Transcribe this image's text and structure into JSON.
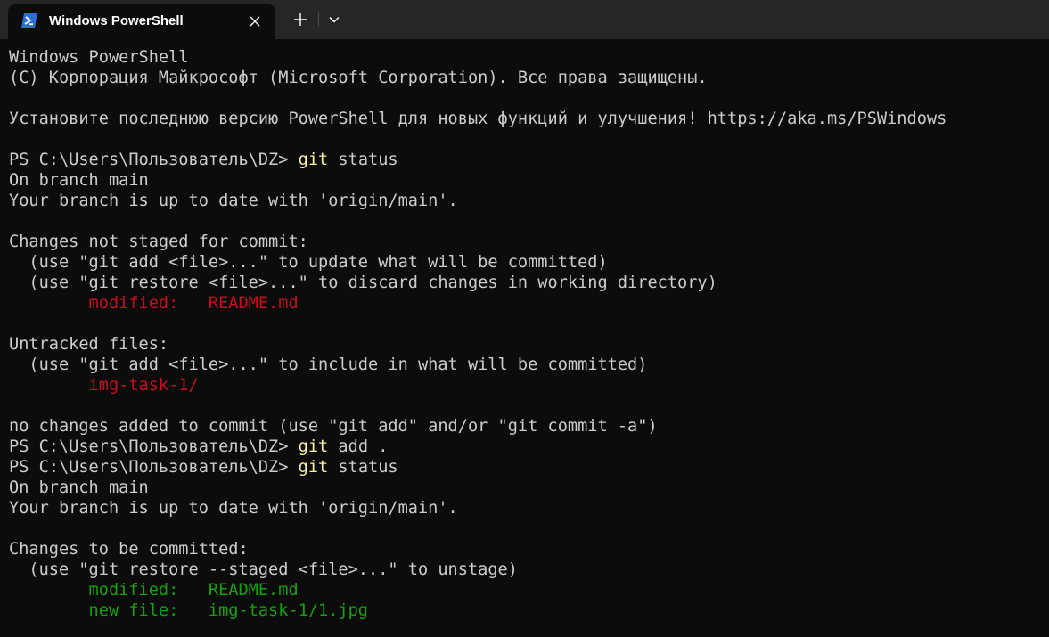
{
  "window": {
    "tab_title": "Windows PowerShell",
    "tab_icon": "powershell-icon",
    "close_icon": "close-icon",
    "new_tab_icon": "plus-icon",
    "dropdown_icon": "chevron-down-icon"
  },
  "colors": {
    "background": "#0c0c0c",
    "titlebar": "#262626",
    "text": "#cccccc",
    "command": "#f9f1a5",
    "red": "#c50f1f",
    "green": "#13a10e",
    "tab_icon": "#2b6fd6"
  },
  "terminal": {
    "lines": [
      [
        {
          "t": "Windows PowerShell"
        }
      ],
      [
        {
          "t": "(C) Корпорация Майкрософт (Microsoft Corporation). Все права защищены."
        }
      ],
      [],
      [
        {
          "t": "Установите последнюю версию PowerShell для новых функций и улучшения! https://aka.ms/PSWindows"
        }
      ],
      [],
      [
        {
          "t": "PS C:\\Users\\Пользователь\\DZ> "
        },
        {
          "t": "git",
          "c": "cmd"
        },
        {
          "t": " status"
        }
      ],
      [
        {
          "t": "On branch main"
        }
      ],
      [
        {
          "t": "Your branch is up to date with 'origin/main'."
        }
      ],
      [],
      [
        {
          "t": "Changes not staged for commit:"
        }
      ],
      [
        {
          "t": "  (use \"git add <file>...\" to update what will be committed)"
        }
      ],
      [
        {
          "t": "  (use \"git restore <file>...\" to discard changes in working directory)"
        }
      ],
      [
        {
          "t": "        modified:   README.md",
          "c": "red"
        }
      ],
      [],
      [
        {
          "t": "Untracked files:"
        }
      ],
      [
        {
          "t": "  (use \"git add <file>...\" to include in what will be committed)"
        }
      ],
      [
        {
          "t": "        img-task-1/",
          "c": "red"
        }
      ],
      [],
      [
        {
          "t": "no changes added to commit (use \"git add\" and/or \"git commit -a\")"
        }
      ],
      [
        {
          "t": "PS C:\\Users\\Пользователь\\DZ> "
        },
        {
          "t": "git",
          "c": "cmd"
        },
        {
          "t": " add ."
        }
      ],
      [
        {
          "t": "PS C:\\Users\\Пользователь\\DZ> "
        },
        {
          "t": "git",
          "c": "cmd"
        },
        {
          "t": " status"
        }
      ],
      [
        {
          "t": "On branch main"
        }
      ],
      [
        {
          "t": "Your branch is up to date with 'origin/main'."
        }
      ],
      [],
      [
        {
          "t": "Changes to be committed:"
        }
      ],
      [
        {
          "t": "  (use \"git restore --staged <file>...\" to unstage)"
        }
      ],
      [
        {
          "t": "        modified:   README.md",
          "c": "green"
        }
      ],
      [
        {
          "t": "        new file:   img-task-1/1.jpg",
          "c": "green"
        }
      ]
    ]
  }
}
